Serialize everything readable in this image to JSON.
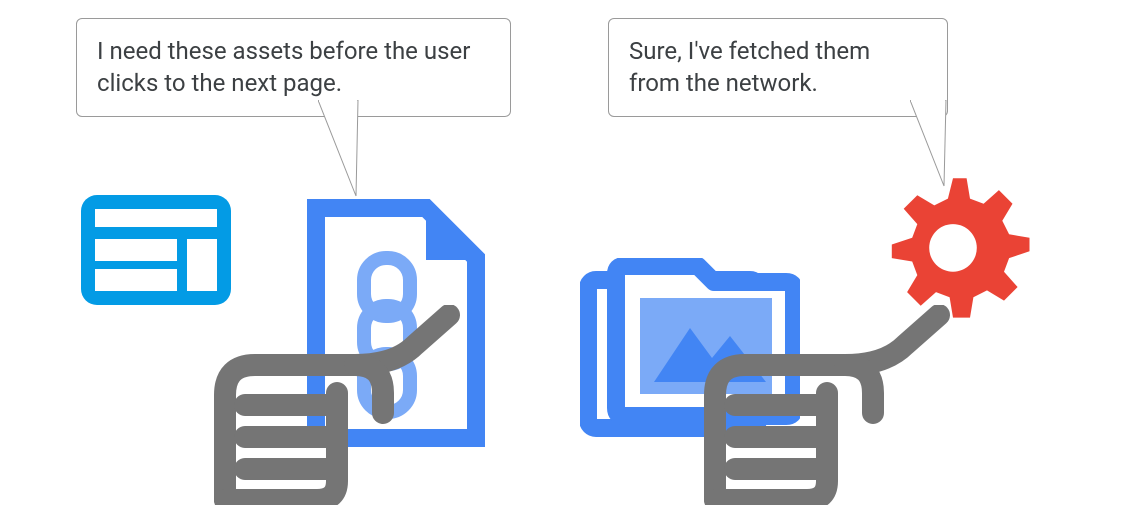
{
  "bubbles": {
    "left": {
      "text": "I need these assets before the user clicks to the next page."
    },
    "right": {
      "text": "Sure, I've fetched them from the network."
    }
  },
  "colors": {
    "bright_blue": "#039be5",
    "blue": "#4285f4",
    "blue_outline": "#3a84ea",
    "light_blue": "#7baaf7",
    "red": "#ea4335",
    "gray": "#757575",
    "border": "#9a9a9a",
    "text": "#3c4043"
  },
  "icons": {
    "browser": "browser-window-icon",
    "hand_left": "hand-pointing-icon",
    "document_chain": "document-chain-icon",
    "folder_image": "image-folder-icon",
    "hand_right": "hand-pointing-icon",
    "gear": "gear-icon"
  }
}
